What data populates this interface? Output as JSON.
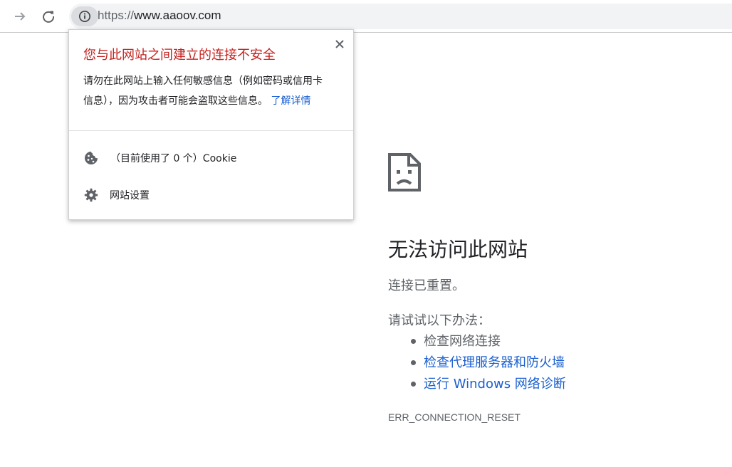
{
  "toolbar": {
    "url_scheme": "https://",
    "url_host": "www.aaoov.com"
  },
  "popup": {
    "title": "您与此网站之间建立的连接不安全",
    "body_line1": "请勿在此网站上输入任何敏感信息（例如密码或信用卡",
    "body_line2": "信息），因为攻击者可能会盗取这些信息。",
    "learn_more": "了解详情",
    "cookies_label": "（目前使用了 0 个）Cookie",
    "site_settings_label": "网站设置"
  },
  "error_page": {
    "title": "无法访问此网站",
    "subtitle": "连接已重置。",
    "try_label": "请试试以下办法：",
    "suggestions": [
      {
        "label": "检查网络连接",
        "link": false
      },
      {
        "label": "检查代理服务器和防火墙",
        "link": true
      },
      {
        "label": "运行 Windows 网络诊断",
        "link": true
      }
    ],
    "error_code": "ERR_CONNECTION_RESET"
  },
  "icons": {
    "forward": "forward-arrow-icon",
    "reload": "reload-icon",
    "info": "info-icon",
    "close": "close-icon",
    "cookie": "cookie-icon",
    "settings": "gear-icon",
    "error": "sad-document-icon"
  },
  "colors": {
    "warning_title": "#c5221f",
    "link": "#1a5fd0",
    "secondary_text": "#5f6368"
  }
}
